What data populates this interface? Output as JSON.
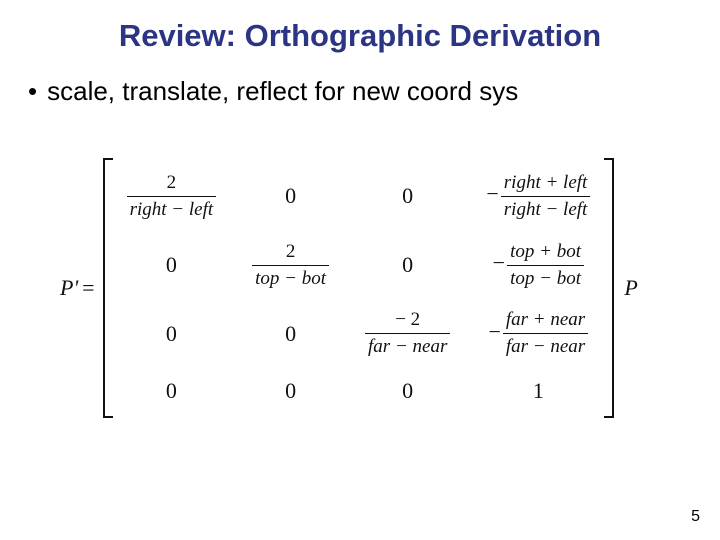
{
  "title": "Review: Orthographic Derivation",
  "bullet": "scale, translate, reflect for new coord sys",
  "lhs": "P'",
  "eq": "=",
  "rhs": "P",
  "matrix": {
    "r0": {
      "c0": {
        "num": "2",
        "den": "right − left"
      },
      "c1": "0",
      "c2": "0",
      "c3": {
        "neg": "−",
        "num": "right + left",
        "den": "right − left"
      }
    },
    "r1": {
      "c0": "0",
      "c1": {
        "num": "2",
        "den": "top − bot"
      },
      "c2": "0",
      "c3": {
        "neg": "−",
        "num": "top + bot",
        "den": "top − bot"
      }
    },
    "r2": {
      "c0": "0",
      "c1": "0",
      "c2": {
        "num": "− 2",
        "den": "far − near"
      },
      "c3": {
        "neg": "−",
        "num": "far + near",
        "den": "far − near"
      }
    },
    "r3": {
      "c0": "0",
      "c1": "0",
      "c2": "0",
      "c3": "1"
    }
  },
  "page": "5"
}
